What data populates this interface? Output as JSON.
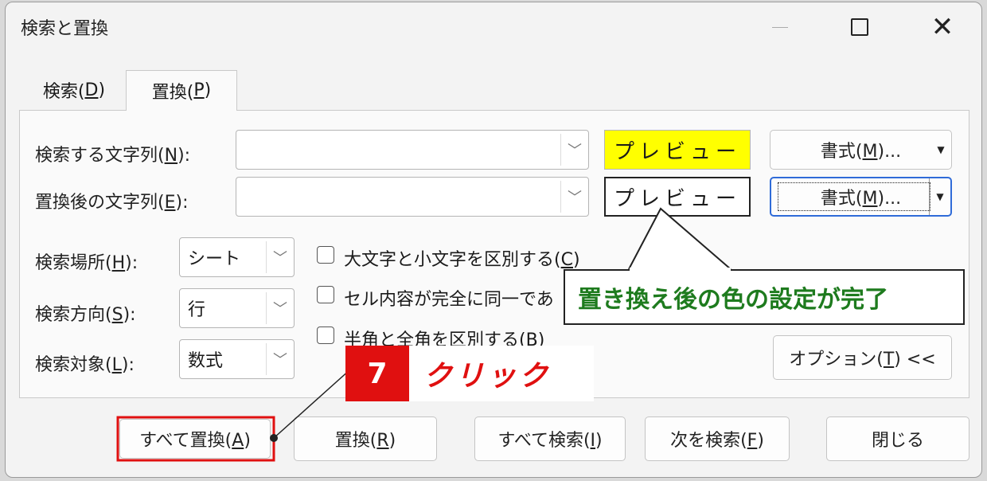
{
  "window": {
    "title": "検索と置換"
  },
  "tabs": [
    {
      "label": "検索(",
      "key": "D",
      "end": ")"
    },
    {
      "label": "置換(",
      "key": "P",
      "end": ")"
    }
  ],
  "find": {
    "label": "検索する文字列(",
    "key": "N",
    "end": "):",
    "value": "",
    "preview": "プレビュー",
    "preview_bg": "#ffff00"
  },
  "replace": {
    "label": "置換後の文字列(",
    "key": "E",
    "end": "):",
    "value": "",
    "preview": "プレビュー"
  },
  "format_button": {
    "label": "書式(",
    "key": "M",
    "end": ")..."
  },
  "options": {
    "within": {
      "label": "検索場所(",
      "key": "H",
      "end": "):",
      "value": "シート"
    },
    "search": {
      "label": "検索方向(",
      "key": "S",
      "end": "):",
      "value": "行"
    },
    "look_in": {
      "label": "検索対象(",
      "key": "L",
      "end": "):",
      "value": "数式"
    },
    "match_case": {
      "label": "大文字と小文字を区別する(",
      "key": "C",
      "end": ")",
      "checked": false
    },
    "match_entire": {
      "label": "セル内容が完全に同一であ",
      "checked": false
    },
    "match_byte": {
      "label": "半角と全角を区別する(",
      "key": "B",
      "end": ")",
      "checked": false
    },
    "options_button": {
      "label": "オプション(",
      "key": "T",
      "end": ") <<"
    }
  },
  "buttons": {
    "replace_all": {
      "label": "すべて置換(",
      "key": "A",
      "end": ")"
    },
    "replace": {
      "label": "置換(",
      "key": "R",
      "end": ")"
    },
    "find_all": {
      "label": "すべて検索(",
      "key": "I",
      "end": ")"
    },
    "find_next": {
      "label": "次を検索(",
      "key": "F",
      "end": ")"
    },
    "close": {
      "label": "閉じる"
    }
  },
  "annotations": {
    "callout": {
      "text": "置き換え後の色の設定が完了",
      "color": "#1e7b1e"
    },
    "step": {
      "number": "7",
      "text": "クリック",
      "color": "#e01010"
    }
  }
}
